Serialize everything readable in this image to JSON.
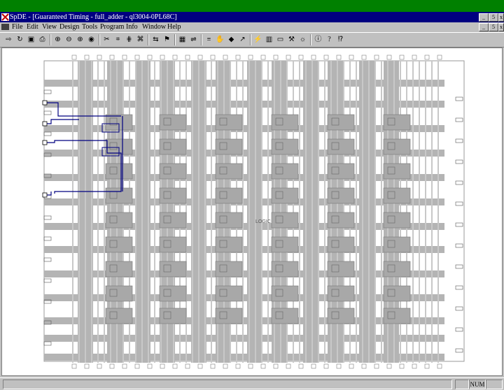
{
  "window": {
    "title": "SpDE - [Guaranteed Timing - full_adder - ql3004-0PL68C]",
    "caption_buttons": [
      "_",
      "5",
      "x"
    ],
    "mdi_buttons": [
      "_",
      "5",
      "x"
    ]
  },
  "menu": [
    "File",
    "Edit",
    "View",
    "Design",
    "Tools",
    "Program",
    "Info",
    "Window",
    "Help"
  ],
  "toolbar": {
    "buttons": [
      {
        "name": "open-icon",
        "glyph": "⇨"
      },
      {
        "name": "reopen-icon",
        "glyph": "↻"
      },
      {
        "name": "save-icon",
        "glyph": "▣"
      },
      {
        "name": "print-icon",
        "glyph": "⎙"
      },
      {
        "name": "zoom-fit-icon",
        "glyph": "⊕"
      },
      {
        "name": "zoom-out-icon",
        "glyph": "⊖"
      },
      {
        "name": "zoom-in-icon",
        "glyph": "⊕"
      },
      {
        "name": "zoom-area-icon",
        "glyph": "◉"
      },
      {
        "name": "route-icon",
        "glyph": "✂"
      },
      {
        "name": "place-icon",
        "glyph": "⌗"
      },
      {
        "name": "net-icon",
        "glyph": "⋕"
      },
      {
        "name": "select-icon",
        "glyph": "⌘"
      },
      {
        "name": "pin-icon",
        "glyph": "⇆"
      },
      {
        "name": "flag-icon",
        "glyph": "⚑"
      },
      {
        "name": "grid-icon",
        "glyph": "▦"
      },
      {
        "name": "edit-icon",
        "glyph": "⇌"
      },
      {
        "name": "layer-icon",
        "glyph": "≡"
      },
      {
        "name": "hand-icon",
        "glyph": "✋"
      },
      {
        "name": "tag-icon",
        "glyph": "◆"
      },
      {
        "name": "run-icon",
        "glyph": "↗"
      },
      {
        "name": "wand-icon",
        "glyph": "⚡"
      },
      {
        "name": "chart-icon",
        "glyph": "▥"
      },
      {
        "name": "doc-icon",
        "glyph": "▭"
      },
      {
        "name": "tools-icon",
        "glyph": "⚒"
      },
      {
        "name": "bulb-icon",
        "glyph": "☼"
      },
      {
        "name": "info-icon",
        "glyph": "ⓘ"
      },
      {
        "name": "help-icon",
        "glyph": "?"
      },
      {
        "name": "context-help-icon",
        "glyph": "⁉"
      }
    ]
  },
  "layout": {
    "cell_label": "LOGIC"
  },
  "status": {
    "num": "NUM"
  },
  "colors": {
    "titlebar": "#000080",
    "desktop": "#008000",
    "routing": "#b4b4b4",
    "net_highlight": "#000080"
  }
}
